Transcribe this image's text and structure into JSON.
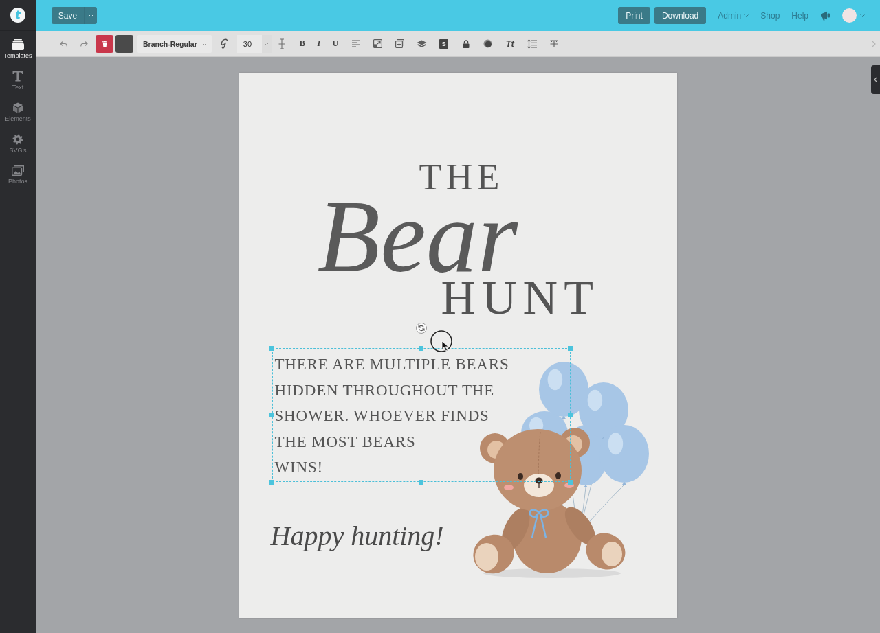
{
  "sidebar": {
    "logo": "t",
    "items": [
      {
        "label": "Templates",
        "selected": true
      },
      {
        "label": "Text",
        "selected": false
      },
      {
        "label": "Elements",
        "selected": false
      },
      {
        "label": "SVG's",
        "selected": false
      },
      {
        "label": "Photos",
        "selected": false
      }
    ]
  },
  "top_bar": {
    "save_button": "Save",
    "buttons": [
      "Print",
      "Download"
    ],
    "links": [
      {
        "label": "Admin",
        "has_menu": true
      },
      {
        "label": "Shop",
        "has_menu": false
      },
      {
        "label": "Help",
        "has_menu": false
      }
    ]
  },
  "toolbar": {
    "color_swatch": {
      "color": "#4a4a4a"
    },
    "font": "Branch-Regular",
    "font_size": "30",
    "format_buttons": [
      "B",
      "I",
      "U"
    ],
    "letter_tile": "S",
    "case_button": "Tt"
  },
  "canvas": {
    "title_top": "THE",
    "title_script": "Bear",
    "title_bottom": "HUNT",
    "paragraph": {
      "text": "THERE ARE MULTIPLE BEARS\nHIDDEN THROUGHOUT THE\nSHOWER. WHOEVER FINDS\nTHE MOST BEARS\nWINS!",
      "selected": true
    },
    "signoff": "Happy hunting!"
  }
}
